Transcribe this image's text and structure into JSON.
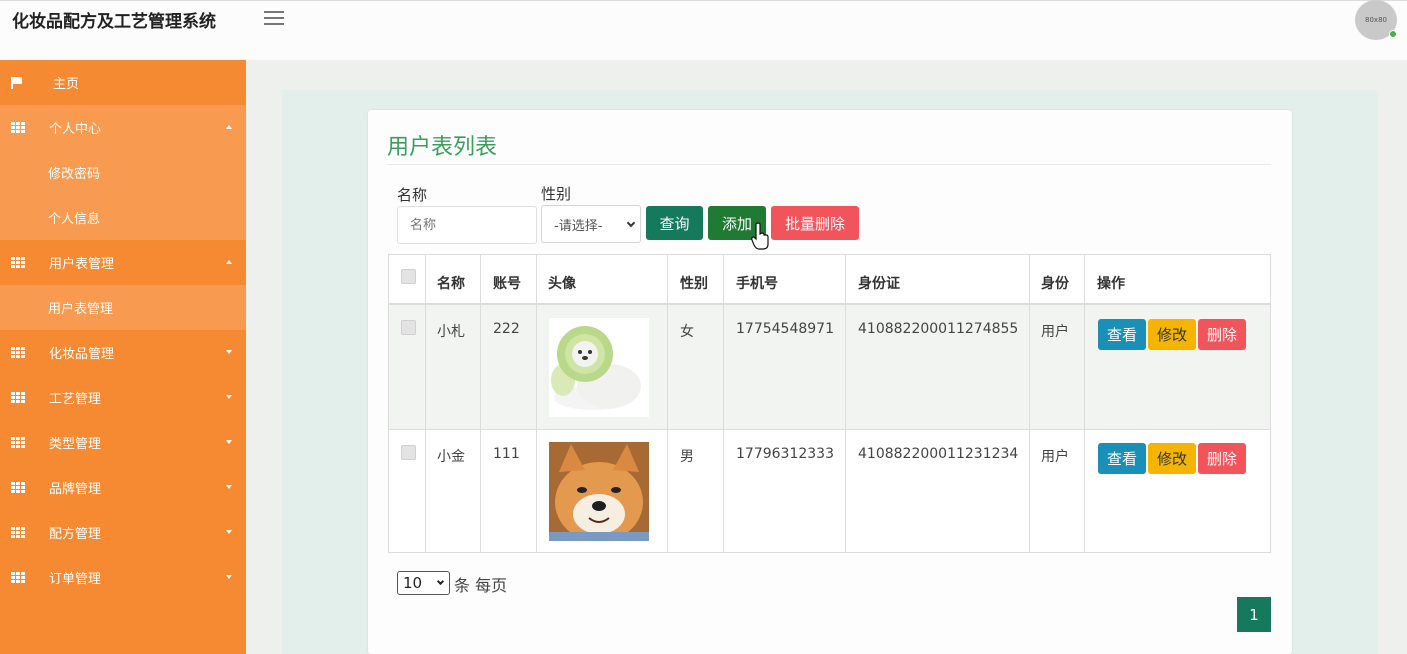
{
  "header": {
    "app_title": "化妆品配方及工艺管理系统",
    "avatar_text": "80x80"
  },
  "sidebar": {
    "home": "主页",
    "groups": [
      {
        "label": "个人中心",
        "subs": [
          "修改密码",
          "个人信息"
        ]
      },
      {
        "label": "用户表管理",
        "subs": [
          "用户表管理"
        ]
      },
      {
        "label": "化妆品管理"
      },
      {
        "label": "工艺管理"
      },
      {
        "label": "类型管理"
      },
      {
        "label": "品牌管理"
      },
      {
        "label": "配方管理"
      },
      {
        "label": "订单管理"
      }
    ]
  },
  "main": {
    "title": "用户表列表",
    "filters": {
      "name_label": "名称",
      "name_placeholder": "名称",
      "gender_label": "性别",
      "gender_value": "-请选择-"
    },
    "buttons": {
      "query": "查询",
      "add": "添加",
      "batch_delete": "批量删除"
    },
    "table": {
      "headers": [
        "名称",
        "账号",
        "头像",
        "性别",
        "手机号",
        "身份证",
        "身份",
        "操作"
      ],
      "rows": [
        {
          "name": "小札",
          "account": "222",
          "gender": "女",
          "phone": "17754548971",
          "id_card": "410882200011274855",
          "role": "用户",
          "avatar": "cabbage-dog"
        },
        {
          "name": "小金",
          "account": "111",
          "gender": "男",
          "phone": "17796312333",
          "id_card": "410882200011231234",
          "role": "用户",
          "avatar": "shiba-inu"
        }
      ],
      "actions": {
        "view": "查看",
        "edit": "修改",
        "delete": "删除"
      }
    },
    "pagination": {
      "page_size": "10",
      "per_page_label": "条 每页",
      "current_page": "1"
    }
  },
  "colors": {
    "sidebar": "#f68a33",
    "accent_green": "#157a5b",
    "title_green": "#3c9e5c",
    "danger": "#f2545b",
    "info": "#1a8fb8",
    "warning": "#f5b400"
  }
}
